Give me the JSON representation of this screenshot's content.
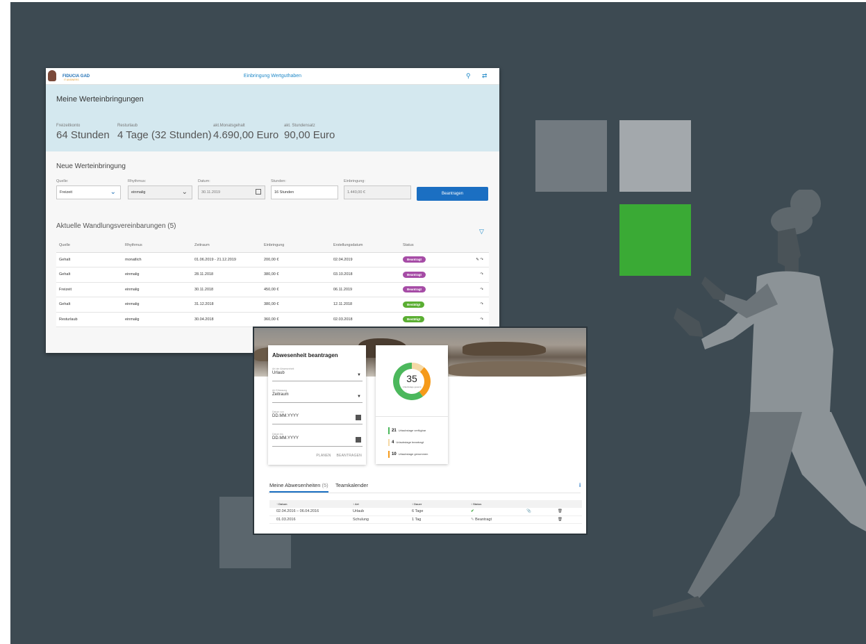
{
  "screen1": {
    "logo_text": "FIDUCIA GAD",
    "logo_sub": "IT ANSWERS",
    "title": "Einbringung Wertguthaben",
    "hero": {
      "heading": "Meine Werteinbringungen",
      "kpis": [
        {
          "label": "Freizeitkonto",
          "value": "64 Stunden"
        },
        {
          "label": "Resturlaub",
          "value": "4 Tage (32 Stunden)"
        },
        {
          "label": "akt.Monatsgehalt",
          "value": "4.690,00 Euro"
        },
        {
          "label": "akt. Stundensatz",
          "value": "90,00 Euro"
        }
      ]
    },
    "form": {
      "heading": "Neue Werteinbringung",
      "quelle_label": "Quelle:",
      "quelle_value": "Freizeit",
      "rhythmus_label": "Rhythmus:",
      "rhythmus_value": "einmalig",
      "datum_label": "Datum:",
      "datum_value": "30.11.2019",
      "stunden_label": "Stunden:",
      "stunden_value": "16 Stunden",
      "einbringung_label": "Einbringung:",
      "einbringung_value": "1.440,00 €",
      "submit_label": "Beantragen"
    },
    "table": {
      "heading": "Aktuelle Wandlungsvereinbarungen (5)",
      "columns": [
        "Quelle",
        "Rhythmus",
        "Zeitraum",
        "Einbringung",
        "Erstellungsdatum",
        "Status"
      ],
      "rows": [
        {
          "quelle": "Gehalt",
          "rhythmus": "monatlich",
          "zeitraum": "01.06.2019 - 21.12.2019",
          "einbringung": "200,00 €",
          "datum": "02.04.2019",
          "status": "Beantragt"
        },
        {
          "quelle": "Gehalt",
          "rhythmus": "einmalig",
          "zeitraum": "28.11.2018",
          "einbringung": "380,00 €",
          "datum": "03.10.2018",
          "status": "Beantragt"
        },
        {
          "quelle": "Freizeit",
          "rhythmus": "einmalig",
          "zeitraum": "30.11.2018",
          "einbringung": "450,00 €",
          "datum": "06.11.2019",
          "status": "Beantragt"
        },
        {
          "quelle": "Gehalt",
          "rhythmus": "einmalig",
          "zeitraum": "31.12.2018",
          "einbringung": "380,00 €",
          "datum": "12.11.2018",
          "status": "Bestätigt"
        },
        {
          "quelle": "Resturlaub",
          "rhythmus": "einmalig",
          "zeitraum": "30.04.2018",
          "einbringung": "360,00 €",
          "datum": "02.03.2018",
          "status": "Bestätigt"
        }
      ]
    },
    "colors": {
      "beantragt": "#a64ca6",
      "bestaetigt": "#5aae32",
      "primary": "#1b6fc2"
    }
  },
  "screen2": {
    "form": {
      "heading": "Abwesenheit beantragen",
      "art_label": "Art der Abwesenheit",
      "art_value": "Urlaub",
      "erfassung_label": "Art Erfassung",
      "erfassung_value": "Zeitraum",
      "von_label": "Datum von",
      "von_value": "DD.MM.YYYY",
      "bis_label": "Datum bis",
      "bis_value": "DD.MM.YYYY",
      "plan_label": "PLANEN",
      "submit_label": "BEANTRAGEN"
    },
    "donut": {
      "total": "35",
      "total_label": "Urlaubstage gesamt",
      "legend": [
        {
          "value": "21",
          "label": "Urlaubstage verfügbar",
          "color": "#4cb85c"
        },
        {
          "value": "4",
          "label": "Urlaubstage beantragt",
          "color": "#f5d9a6"
        },
        {
          "value": "10",
          "label": "Urlaubstage genommen",
          "color": "#f59a1a"
        }
      ]
    },
    "tabs": {
      "active": "Meine Abwesenheiten",
      "count": "(5)",
      "other": "Teamkalender"
    },
    "table": {
      "columns": [
        "Datum",
        "Art",
        "Dauer",
        "Status"
      ],
      "rows": [
        {
          "datum": "02.04.2016 – 06.04.2016",
          "art": "Urlaub",
          "dauer": "6 Tage",
          "status": "✔"
        },
        {
          "datum": "01.03.2016",
          "art": "Schulung",
          "dauer": "1 Tag",
          "status": "Beantragt"
        }
      ]
    }
  }
}
